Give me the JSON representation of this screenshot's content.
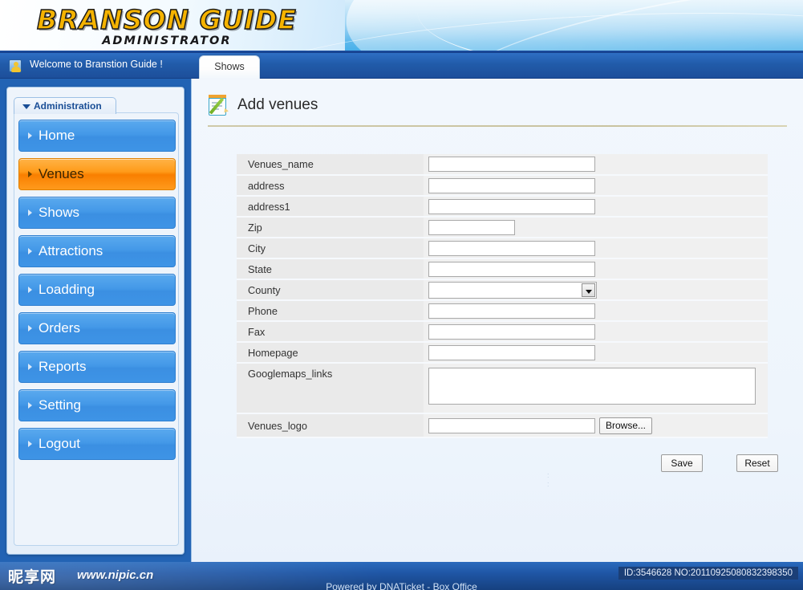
{
  "header": {
    "logo_main": "BRANSON GUIDE",
    "logo_sub": "ADMINISTRATOR"
  },
  "welcome_bar": {
    "text": "Welcome to Branstion Guide !",
    "user_icon": "user-icon"
  },
  "tabs": [
    {
      "label": "Shows",
      "active": true
    }
  ],
  "sidebar": {
    "panel_title": "Administration",
    "caret_icon": "chevron-down-icon",
    "items": [
      {
        "label": "Home",
        "active": false
      },
      {
        "label": "Venues",
        "active": true
      },
      {
        "label": "Shows",
        "active": false
      },
      {
        "label": "Attractions",
        "active": false
      },
      {
        "label": "Loadding",
        "active": false
      },
      {
        "label": "Orders",
        "active": false
      },
      {
        "label": "Reports",
        "active": false
      },
      {
        "label": "Setting",
        "active": false
      },
      {
        "label": "Logout",
        "active": false
      }
    ]
  },
  "main": {
    "page_title": "Add venues",
    "page_icon": "notepad-pencil-icon",
    "form": {
      "rows": [
        {
          "label": "Venues_name",
          "type": "text",
          "value": "",
          "width": "wide"
        },
        {
          "label": "address",
          "type": "text",
          "value": "",
          "width": "wide"
        },
        {
          "label": "address1",
          "type": "text",
          "value": "",
          "width": "wide"
        },
        {
          "label": "Zip",
          "type": "text",
          "value": "",
          "width": "zip"
        },
        {
          "label": "City",
          "type": "text",
          "value": "",
          "width": "wide"
        },
        {
          "label": "State",
          "type": "text",
          "value": "",
          "width": "wide"
        },
        {
          "label": "County",
          "type": "select",
          "value": "",
          "width": "wide"
        },
        {
          "label": "Phone",
          "type": "text",
          "value": "",
          "width": "wide"
        },
        {
          "label": "Fax",
          "type": "text",
          "value": "",
          "width": "wide"
        },
        {
          "label": "Homepage",
          "type": "text",
          "value": "",
          "width": "wide"
        },
        {
          "label": "Googlemaps_links",
          "type": "textarea",
          "value": "",
          "width": "area"
        },
        {
          "label": "Venues_logo",
          "type": "file",
          "value": "",
          "width": "wide"
        }
      ],
      "browse_label": "Browse...",
      "save_label": "Save",
      "reset_label": "Reset"
    }
  },
  "footer": {
    "watermark_cn": "昵享网",
    "watermark_url": "www.nipic.cn",
    "powered_by": "Powered by DNATicket - Box Office",
    "id_badge": "ID:3546628 NO:20110925080832398350"
  },
  "colors": {
    "accent_blue": "#2263b4",
    "active_orange": "#f97f00",
    "logo_gold": "#F5B301",
    "nav_blue": "#4499e8",
    "label_cell": "#eaeaea",
    "content_bg": "#eef5fc"
  }
}
